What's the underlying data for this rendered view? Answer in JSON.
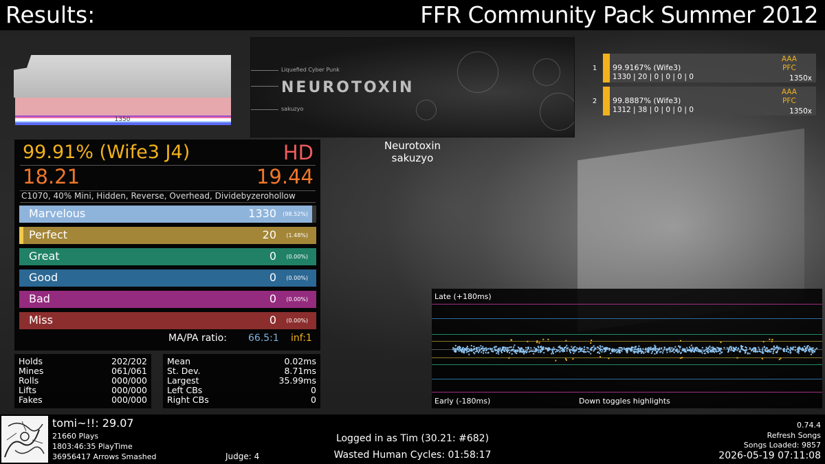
{
  "header": {
    "title": "Results:",
    "pack": "FFR Community Pack Summer 2012"
  },
  "graph": {
    "label": "1350"
  },
  "banner": {
    "genre": "Liquefied Cyber Punk",
    "title": "NEUROTOXIN",
    "artist": "sakuzyo"
  },
  "song": {
    "name": "Neurotoxin",
    "artist": "sakuzyo"
  },
  "leaderboard": [
    {
      "rank": "1",
      "accuracy": "99.9167% (Wife3)",
      "judgments": "1330 | 20 | 0 | 0 | 0 | 0",
      "grade": "AAA",
      "fc": "PFC",
      "rate": "1350x"
    },
    {
      "rank": "2",
      "accuracy": "99.8887% (Wife3)",
      "judgments": "1312 | 38 | 0 | 0 | 0 | 0",
      "grade": "AAA",
      "fc": "PFC",
      "rate": "1350x"
    }
  ],
  "score": {
    "accuracy": "99.91% (Wife3 J4)",
    "grade": "HD",
    "msd": "18.21",
    "ssr": "19.44",
    "mods": "C1070, 40% Mini, Hidden, Reverse, Overhead, Dividebyzerohollow"
  },
  "judgments": [
    {
      "name": "Marvelous",
      "count": "1330",
      "pct": "(98.52%)",
      "fill": 0.9852,
      "color": "#8fb4dc"
    },
    {
      "name": "Perfect",
      "count": "20",
      "pct": "(1.48%)",
      "fill": 0.0148,
      "color": "#c9a23a"
    },
    {
      "name": "Great",
      "count": "0",
      "pct": "(0.00%)",
      "fill": 0,
      "color": "#1e8a6b"
    },
    {
      "name": "Good",
      "count": "0",
      "pct": "(0.00%)",
      "fill": 0,
      "color": "#2a6e9e"
    },
    {
      "name": "Bad",
      "count": "0",
      "pct": "(0.00%)",
      "fill": 0,
      "color": "#a02a86"
    },
    {
      "name": "Miss",
      "count": "0",
      "pct": "(0.00%)",
      "fill": 0,
      "color": "#962e2e"
    }
  ],
  "ratio": {
    "label": "MA/PA ratio:",
    "ma": "66.5:1",
    "pa": "inf:1"
  },
  "holds": [
    {
      "label": "Holds",
      "value": "202/202"
    },
    {
      "label": "Mines",
      "value": "061/061"
    },
    {
      "label": "Rolls",
      "value": "000/000"
    },
    {
      "label": "Lifts",
      "value": "000/000"
    },
    {
      "label": "Fakes",
      "value": "000/000"
    }
  ],
  "offsets": [
    {
      "label": "Mean",
      "value": "0.02ms"
    },
    {
      "label": "St. Dev.",
      "value": "8.71ms"
    },
    {
      "label": "Largest",
      "value": "35.99ms"
    },
    {
      "label": "Left CBs",
      "value": "0"
    },
    {
      "label": "Right CBs",
      "value": "0"
    }
  ],
  "plot": {
    "late": "Late (+180ms)",
    "early": "Early (-180ms)",
    "toggle": "Down toggles highlights",
    "range_ms": [
      -180,
      180
    ],
    "dot_color": "#8ec6f5",
    "perfect_dot_color": "#f2b21c"
  },
  "player": {
    "name": "tomi~!!: 29.07",
    "plays": "21660 Plays",
    "playtime": "1803:46:35 PlayTime",
    "arrows": "36956417 Arrows Smashed",
    "judge": "Judge: 4"
  },
  "session": {
    "login": "Logged in as Tim (30.21: #682)",
    "wasted": "Wasted Human Cycles: 01:58:17"
  },
  "sysinfo": {
    "version": "0.74.4",
    "refresh": "Refresh Songs",
    "songs": "Songs Loaded: 9857",
    "datetime": "2026-05-19 07:11:08"
  }
}
